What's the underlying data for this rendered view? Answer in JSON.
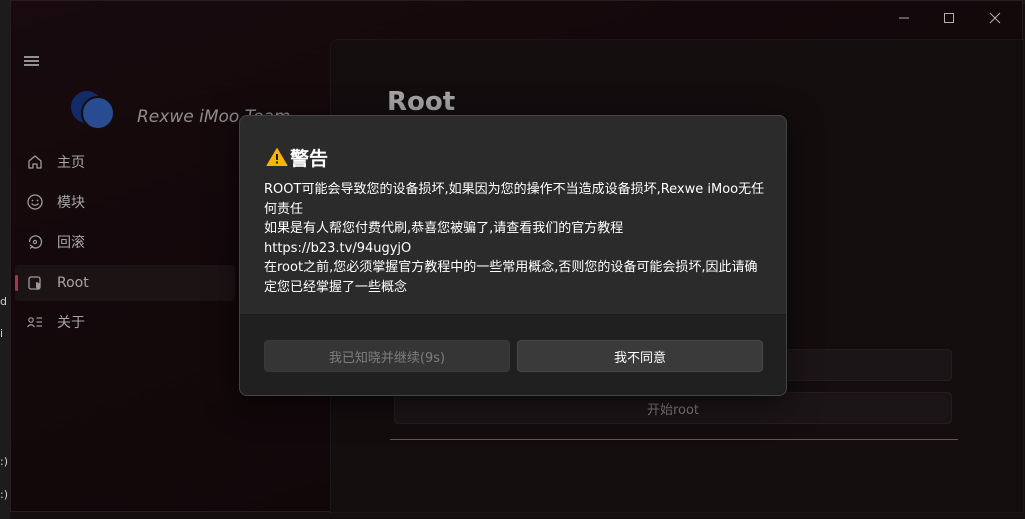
{
  "window": {
    "brand": "Rexwe iMoo Team"
  },
  "nav": {
    "items": [
      {
        "label": "主页",
        "icon": "home-icon"
      },
      {
        "label": "模块",
        "icon": "emoji-icon"
      },
      {
        "label": "回滚",
        "icon": "rollback-icon"
      },
      {
        "label": "Root",
        "icon": "root-icon",
        "selected": true
      },
      {
        "label": "关于",
        "icon": "about-icon"
      }
    ]
  },
  "page": {
    "title": "Root",
    "start_button": "开始root"
  },
  "background_fragments": [
    "d",
    "i",
    ":)",
    ":)"
  ],
  "dialog": {
    "title": "警告",
    "body": [
      "ROOT可能会导致您的设备损坏,如果因为您的操作不当造成设备损坏,Rexwe iMoo无任何责任",
      "如果是有人帮您付费代刷,恭喜您被骗了,请查看我们的官方教程https://b23.tv/94ugyjO",
      "在root之前,您必须掌握官方教程中的一些常用概念,否则您的设备可能会损坏,因此请确定您已经掌握了一些概念"
    ],
    "continue_button": "我已知晓并继续(9s)",
    "decline_button": "我不同意"
  },
  "colors": {
    "accent": "#e05a6e",
    "warning": "#f7b500",
    "logo_blue": "#3b6fd6"
  }
}
